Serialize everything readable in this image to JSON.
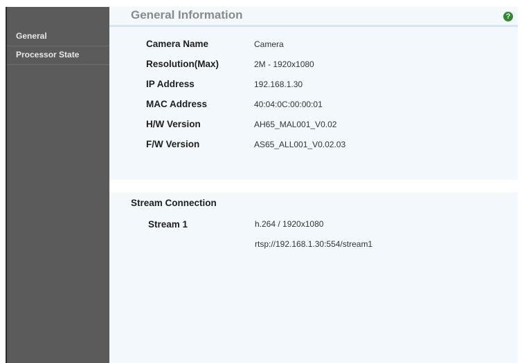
{
  "sidebar": {
    "items": [
      {
        "label": "General"
      },
      {
        "label": "Processor State"
      }
    ]
  },
  "header": {
    "title": "General Information",
    "help_icon": "question-circle-icon",
    "help_glyph": "?"
  },
  "general_info": {
    "rows": [
      {
        "label": "Camera Name",
        "value": "Camera"
      },
      {
        "label": "Resolution(Max)",
        "value": "2M - 1920x1080"
      },
      {
        "label": "IP Address",
        "value": "192.168.1.30"
      },
      {
        "label": "MAC Address",
        "value": "40:04:0C:00:00:01"
      },
      {
        "label": "H/W Version",
        "value": "AH65_MAL001_V0.02"
      },
      {
        "label": "F/W Version",
        "value": "AS65_ALL001_V0.02.03"
      }
    ]
  },
  "stream_connection": {
    "title": "Stream Connection",
    "streams": [
      {
        "label": "Stream 1",
        "codec": "h.264 / 1920x1080",
        "url": "rtsp://192.168.1.30:554/stream1"
      }
    ]
  },
  "colors": {
    "sidebar_bg": "#5b5b5b",
    "content_bg": "#f3f8fc",
    "help_icon": "#2f8a2f"
  }
}
